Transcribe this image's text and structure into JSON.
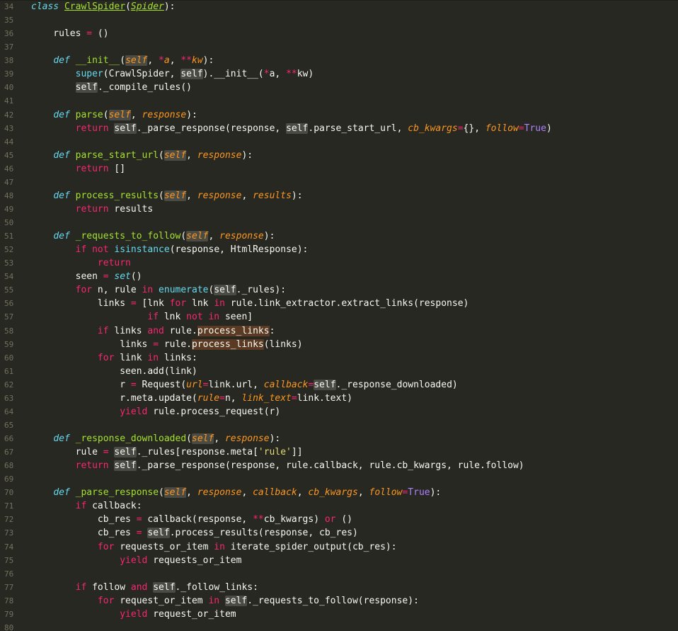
{
  "editor": {
    "language": "python",
    "theme": "monokai",
    "lines": [
      {
        "n": "34",
        "html": "<span class=\"def\">class</span> <span class=\"cls\">CrawlSpider</span>(<span class=\"cls\" style=\"font-style:italic\">Spider</span>):"
      },
      {
        "n": "35",
        "html": ""
      },
      {
        "n": "36",
        "html": "    rules <span class=\"op\">=</span> ()"
      },
      {
        "n": "37",
        "html": ""
      },
      {
        "n": "38",
        "html": "    <span class=\"def\">def</span> <span class=\"fn\">__init__</span>(<span class=\"selfp\">self</span>, <span class=\"op\">*</span><span class=\"param\">a</span>, <span class=\"op\">**</span><span class=\"param\">kw</span>):"
      },
      {
        "n": "39",
        "html": "        <span class=\"bi\">super</span>(CrawlSpider, <span class=\"self\">self</span>).__init__(<span class=\"op\">*</span>a, <span class=\"op\">**</span>kw)"
      },
      {
        "n": "40",
        "html": "        <span class=\"self\">self</span>._compile_rules()"
      },
      {
        "n": "41",
        "html": ""
      },
      {
        "n": "42",
        "html": "    <span class=\"def\">def</span> <span class=\"fn\">parse</span>(<span class=\"selfp\">self</span>, <span class=\"param\">response</span>):"
      },
      {
        "n": "43",
        "html": "        <span class=\"kw\">return</span> <span class=\"self\">self</span>._parse_response(response, <span class=\"self\">self</span>.parse_start_url, <span class=\"param\">cb_kwargs</span><span class=\"op\">=</span>{}, <span class=\"param\">follow</span><span class=\"op\">=</span><span class=\"const\">True</span>)"
      },
      {
        "n": "44",
        "html": ""
      },
      {
        "n": "45",
        "html": "    <span class=\"def\">def</span> <span class=\"fn\">parse_start_url</span>(<span class=\"selfp\">self</span>, <span class=\"param\">response</span>):"
      },
      {
        "n": "46",
        "html": "        <span class=\"kw\">return</span> []"
      },
      {
        "n": "47",
        "html": ""
      },
      {
        "n": "48",
        "html": "    <span class=\"def\">def</span> <span class=\"fn\">process_results</span>(<span class=\"selfp\">self</span>, <span class=\"param\">response</span>, <span class=\"param\">results</span>):"
      },
      {
        "n": "49",
        "html": "        <span class=\"kw\">return</span> results"
      },
      {
        "n": "50",
        "html": ""
      },
      {
        "n": "51",
        "html": "    <span class=\"def\">def</span> <span class=\"fn\">_requests_to_follow</span>(<span class=\"selfp\">self</span>, <span class=\"param\">response</span>):"
      },
      {
        "n": "52",
        "html": "        <span class=\"kw\">if</span> <span class=\"kw\">not</span> <span class=\"bi\">isinstance</span>(response, HtmlResponse):"
      },
      {
        "n": "53",
        "html": "            <span class=\"kw\">return</span>"
      },
      {
        "n": "54",
        "html": "        seen <span class=\"op\">=</span> <span class=\"bi\" style=\"font-style:italic\">set</span>()"
      },
      {
        "n": "55",
        "html": "        <span class=\"kw\">for</span> n, rule <span class=\"kw\">in</span> <span class=\"bi\">enumerate</span>(<span class=\"self\">self</span>._rules):"
      },
      {
        "n": "56",
        "html": "            links <span class=\"op\">=</span> [lnk <span class=\"kw\">for</span> lnk <span class=\"kw\">in</span> rule.link_extractor.extract_links(response)"
      },
      {
        "n": "57",
        "html": "                     <span class=\"kw\">if</span> lnk <span class=\"kw\">not</span> <span class=\"kw\">in</span> seen]"
      },
      {
        "n": "58",
        "html": "            <span class=\"kw\">if</span> links <span class=\"kw\">and</span> rule.<span class=\"hl\">process_links</span>:"
      },
      {
        "n": "59",
        "html": "                links <span class=\"op\">=</span> rule.<span class=\"hl\">process_links</span>(links)"
      },
      {
        "n": "60",
        "html": "            <span class=\"kw\">for</span> link <span class=\"kw\">in</span> links:"
      },
      {
        "n": "61",
        "html": "                seen.add(link)"
      },
      {
        "n": "62",
        "html": "                r <span class=\"op\">=</span> Request(<span class=\"param\">url</span><span class=\"op\">=</span>link.url, <span class=\"param\">callback</span><span class=\"op\">=</span><span class=\"self\">self</span>._response_downloaded)"
      },
      {
        "n": "63",
        "html": "                r.meta.update(<span class=\"param\">rule</span><span class=\"op\">=</span>n, <span class=\"param\">link_text</span><span class=\"op\">=</span>link.text)"
      },
      {
        "n": "64",
        "html": "                <span class=\"kw\">yield</span> rule.process_request(r)"
      },
      {
        "n": "65",
        "html": ""
      },
      {
        "n": "66",
        "html": "    <span class=\"def\">def</span> <span class=\"fn\">_response_downloaded</span>(<span class=\"selfp\">self</span>, <span class=\"param\">response</span>):"
      },
      {
        "n": "67",
        "html": "        rule <span class=\"op\">=</span> <span class=\"self\">self</span>._rules[response.meta[<span class=\"str\">'rule'</span>]]"
      },
      {
        "n": "68",
        "html": "        <span class=\"kw\">return</span> <span class=\"self\">self</span>._parse_response(response, rule.callback, rule.cb_kwargs, rule.follow)"
      },
      {
        "n": "69",
        "html": ""
      },
      {
        "n": "70",
        "html": "    <span class=\"def\">def</span> <span class=\"fn\">_parse_response</span>(<span class=\"selfp\">self</span>, <span class=\"param\">response</span>, <span class=\"param\">callback</span>, <span class=\"param\">cb_kwargs</span>, <span class=\"param\">follow</span><span class=\"op\">=</span><span class=\"const\">True</span>):"
      },
      {
        "n": "71",
        "html": "        <span class=\"kw\">if</span> callback:"
      },
      {
        "n": "72",
        "html": "            cb_res <span class=\"op\">=</span> callback(response, <span class=\"op\">**</span>cb_kwargs) <span class=\"kw\">or</span> ()"
      },
      {
        "n": "73",
        "html": "            cb_res <span class=\"op\">=</span> <span class=\"self\">self</span>.process_results(response, cb_res)"
      },
      {
        "n": "74",
        "html": "            <span class=\"kw\">for</span> requests_or_item <span class=\"kw\">in</span> iterate_spider_output(cb_res):"
      },
      {
        "n": "75",
        "html": "                <span class=\"kw\">yield</span> requests_or_item"
      },
      {
        "n": "76",
        "html": ""
      },
      {
        "n": "77",
        "html": "        <span class=\"kw\">if</span> follow <span class=\"kw\">and</span> <span class=\"self\">self</span>._follow_links:"
      },
      {
        "n": "78",
        "html": "            <span class=\"kw\">for</span> request_or_item <span class=\"kw\">in</span> <span class=\"self\">self</span>._requests_to_follow(response):"
      },
      {
        "n": "79",
        "html": "                <span class=\"kw\">yield</span> request_or_item"
      },
      {
        "n": "80",
        "html": ""
      }
    ]
  }
}
